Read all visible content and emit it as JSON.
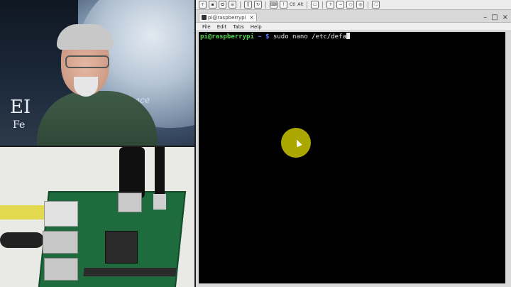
{
  "webcam": {
    "banner_big": "EI",
    "banner_small": "Fe",
    "banner_right": "ace"
  },
  "toolbar": {
    "ctrl_label": "Ctl",
    "alt_label": "Alt"
  },
  "terminal_window": {
    "tab_title": "pi@raspberrypi",
    "tab_close": "×",
    "window_buttons": [
      "–",
      "□",
      "×"
    ],
    "menu": [
      "File",
      "Edit",
      "Tabs",
      "Help"
    ],
    "prompt_user": "pi@raspberrypi",
    "prompt_dir": " ~ $",
    "command": " sudo nano /etc/defa"
  },
  "colors": {
    "prompt_user": "#52d652",
    "prompt_dir": "#5a7bff",
    "terminal_bg": "#000000",
    "cursor_highlight": "#d5d200"
  },
  "icons": [
    "save-icon",
    "copy-icon",
    "options-icon",
    "pause-icon",
    "refresh-icon",
    "keyboard-icon",
    "zoom-in-icon",
    "zoom-out-icon",
    "zoom-fit-icon",
    "fullscreen-icon"
  ]
}
